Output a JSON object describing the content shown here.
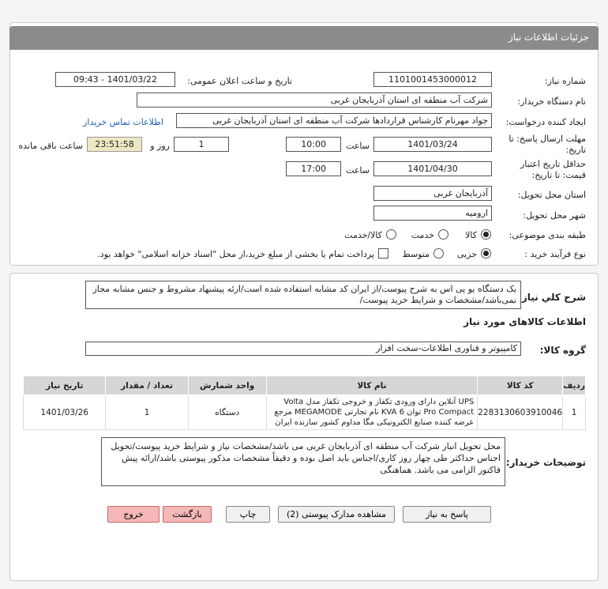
{
  "header": {
    "title": "جزئیات اطلاعات نیاز"
  },
  "form": {
    "need_number_label": "شماره نیاز:",
    "need_number": "1101001453000012",
    "announce_label": "تاریخ و ساعت اعلان عمومی:",
    "announce_value": "1401/03/22 - 09:43",
    "buyer_label": "نام دستگاه خریدار:",
    "buyer_value": "شرکت آب منطقه ای استان آذربایجان غربی",
    "creator_label": "ایجاد کننده درخواست:",
    "creator_value": "جواد مهرنام کارشناس قراردادها شرکت آب منطقه ای استان آذربایجان غربی",
    "contact_link": "اطلاعات تماس خریدار",
    "deadline_label_1": "مهلت ارسال پاسخ: تا",
    "deadline_label_2": "تاریخ:",
    "deadline_date": "1401/03/24",
    "time_label": "ساعت",
    "deadline_time": "10:00",
    "days_value": "1",
    "days_label": "روز و",
    "remaining_time": "23:51:58",
    "remaining_label": "ساعت باقی مانده",
    "validity_label_1": "حداقل تاریخ اعتبار",
    "validity_label_2": "قیمت: تا تاریخ:",
    "validity_date": "1401/04/30",
    "validity_time_label": "ساعت",
    "validity_time": "17:00",
    "province_label": "استان محل تحویل:",
    "province_value": "آذربایجان غربی",
    "city_label": "شهر محل تحویل:",
    "city_value": "ارومیه",
    "category_label": "طبقه بندی موضوعی:",
    "category_options": [
      "کالا",
      "خدمت",
      "کالا/خدمت"
    ],
    "process_label": "نوع فرآیند خرید :",
    "process_options": [
      "جزیی",
      "متوسط"
    ],
    "payment_note": "پرداخت تمام یا بخشی از مبلغ خرید،از محل \"اسناد خزانه اسلامی\" خواهد بود."
  },
  "summary": {
    "label": "شرح کلي نياز:",
    "text": "یک دستگاه یو پی اس به شرح پیوست/از ایران کد مشابه استفاده شده است/ارئه پیشنهاد مشروط و جنس مشابه مجاز نمی‌باشد/مشخصات و شرایط خرید پیوست/"
  },
  "goods": {
    "section_title": "اطلاعات کالاهای مورد نیاز",
    "group_label": "گروه کالا:",
    "group_value": "کامپیوتر و فناوری اطلاعات-سخت افزار",
    "columns": [
      "ردیف",
      "کد کالا",
      "نام کالا",
      "واحد شمارش",
      "تعداد / مقدار",
      "تاریخ نیاز"
    ],
    "rows": [
      {
        "row": "1",
        "code": "2283130603910046",
        "name": "UPS آنلاین دارای ورودی تکفاز و خروجی تکفاز مدل Volta Pro Compact توان 6 KVA نام تجارتی MEGAMODE مرجع عرضه کننده صنایع الکترونیکی مگا مداوم کشور سازنده ایران",
        "unit": "دستگاه",
        "qty": "1",
        "date": "1401/03/26"
      }
    ]
  },
  "buyer_notes": {
    "label": "توضیحات خریدار:",
    "text": "محل تحویل انبار شرکت آب منطقه ای آذربایجان غربی می باشد/مشخصات نیاز و شرایط خرید پیوست/تحویل اجناس حداکثر طی چهار روز کاری/اجناس باید اصل بوده و دقیقاً مشخصات مذکور پیوستی باشد/ارائه پیش فاکتور الزامی می باشد. هماهنگی"
  },
  "buttons": {
    "reply": "پاسخ به نیاز",
    "attachments": "مشاهده مدارک پیوستی (2)",
    "print": "چاپ",
    "back": "بازگشت",
    "exit": "خروج"
  }
}
